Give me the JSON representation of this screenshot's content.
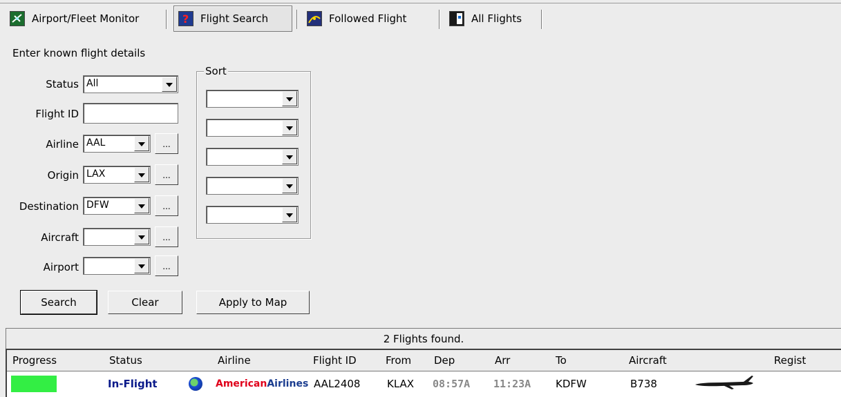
{
  "tabs": [
    {
      "label": "Airport/Fleet Monitor",
      "icon": "airport-monitor-icon",
      "active": false
    },
    {
      "label": "Flight Search",
      "icon": "flight-search-icon",
      "active": true
    },
    {
      "label": "Followed Flight",
      "icon": "followed-flight-icon",
      "active": false
    },
    {
      "label": "All Flights",
      "icon": "all-flights-icon",
      "active": false
    }
  ],
  "form": {
    "heading": "Enter known flight details",
    "status": {
      "label": "Status",
      "value": "All"
    },
    "flight_id": {
      "label": "Flight ID",
      "value": ""
    },
    "airline": {
      "label": "Airline",
      "value": "AAL"
    },
    "origin": {
      "label": "Origin",
      "value": "LAX"
    },
    "destination": {
      "label": "Destination",
      "value": "DFW"
    },
    "aircraft": {
      "label": "Aircraft",
      "value": ""
    },
    "airport": {
      "label": "Airport",
      "value": ""
    },
    "ellipsis": "...",
    "sort": {
      "label": "Sort",
      "values": [
        "",
        "",
        "",
        "",
        ""
      ]
    }
  },
  "buttons": {
    "search": "Search",
    "clear": "Clear",
    "apply": "Apply to Map"
  },
  "results": {
    "summary": "2 Flights found.",
    "columns": [
      "Progress",
      "Status",
      "Airline",
      "Flight ID",
      "From",
      "Dep",
      "Arr",
      "To",
      "Aircraft",
      "Regist"
    ],
    "rows": [
      {
        "progress": 1.0,
        "status": "In-Flight",
        "airline_logo_a": "American",
        "airline_logo_b": "Airlines",
        "flight_id": "AAL2408",
        "from": "KLAX",
        "dep": "08:57A",
        "arr": "11:23A",
        "to": "KDFW",
        "aircraft": "B738",
        "regist": ""
      }
    ]
  },
  "colors": {
    "progress_fill": "#33ee44",
    "status_text": "#0a1a8a",
    "panel_bg": "#ececec"
  }
}
